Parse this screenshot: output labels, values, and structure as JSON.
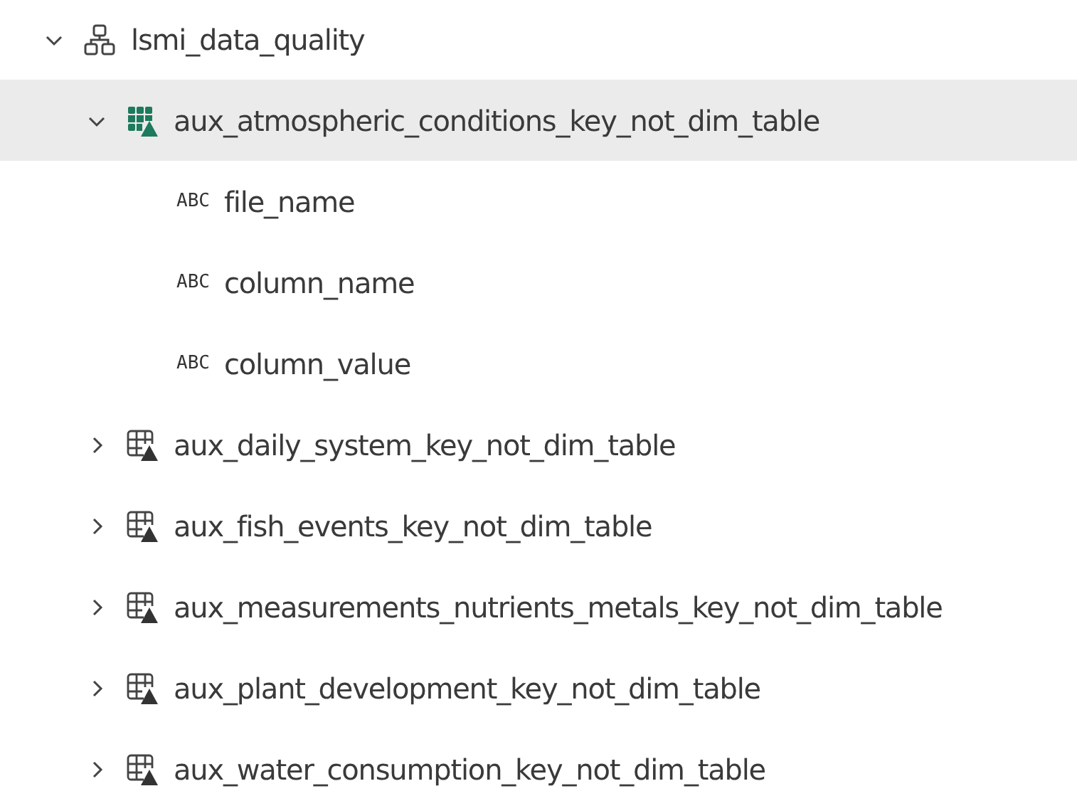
{
  "tree": [
    {
      "label": "lsmi_data_quality",
      "kind": "schema",
      "expanded": true,
      "children": [
        {
          "label": "aux_atmospheric_conditions_key_not_dim_table",
          "kind": "table",
          "expanded": true,
          "selected": true,
          "children": [
            {
              "label": "file_name",
              "kind": "column",
              "type_label": "ABC"
            },
            {
              "label": "column_name",
              "kind": "column",
              "type_label": "ABC"
            },
            {
              "label": "column_value",
              "kind": "column",
              "type_label": "ABC"
            }
          ]
        },
        {
          "label": "aux_daily_system_key_not_dim_table",
          "kind": "table",
          "expanded": false,
          "selected": false
        },
        {
          "label": "aux_fish_events_key_not_dim_table",
          "kind": "table",
          "expanded": false,
          "selected": false
        },
        {
          "label": "aux_measurements_nutrients_metals_key_not_dim_table",
          "kind": "table",
          "expanded": false,
          "selected": false
        },
        {
          "label": "aux_plant_development_key_not_dim_table",
          "kind": "table",
          "expanded": false,
          "selected": false
        },
        {
          "label": "aux_water_consumption_key_not_dim_table",
          "kind": "table",
          "expanded": false,
          "selected": false
        }
      ]
    }
  ]
}
